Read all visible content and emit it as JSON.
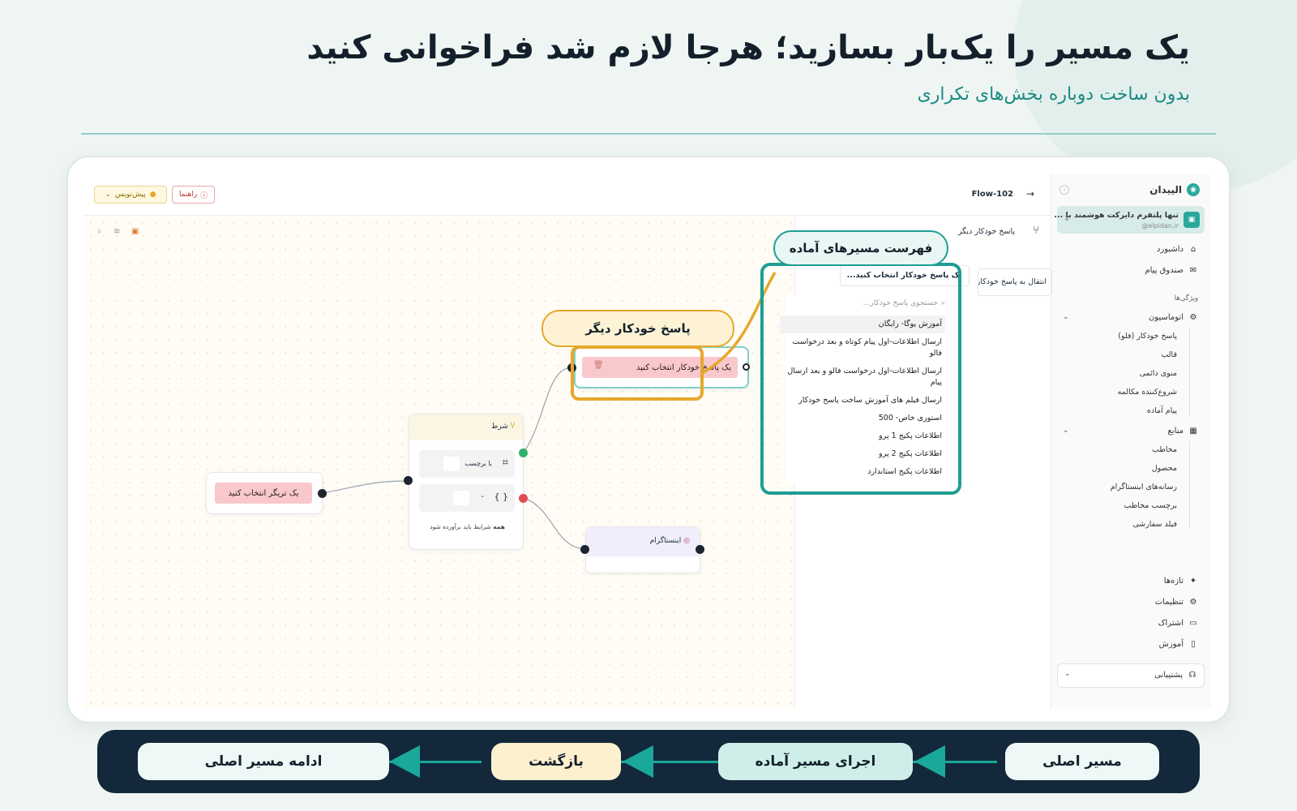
{
  "hero": {
    "title": "یک مسیر را یک‌بار بسازید؛ هرجا لازم شد فراخوانی کنید",
    "subtitle": "بدون ساخت دوباره بخش‌های تکراری"
  },
  "sidebar": {
    "brand": "الپیدان",
    "account_name": "تنها پلتفرم دایرکت هوشمند با ...",
    "account_handle": "@elpidan.ir",
    "dashboard": "داشبورد",
    "inbox": "صندوق پیام",
    "features_heading": "ویژگی‌ها",
    "automation": "اتوماسیون",
    "automation_items": [
      "پاسخ خودکار (فلو)",
      "قالب",
      "منوی دائمی",
      "شروع‌کننده مکالمه",
      "پیام آماده"
    ],
    "resources": "منابع",
    "resources_items": [
      "مخاطب",
      "محصول",
      "رسانه‌های اینستاگرام",
      "برچسب مخاطب",
      "فیلد سفارشی"
    ],
    "news": "تازه‌ها",
    "settings": "تنظیمات",
    "subscription": "اشتراک",
    "tutorial": "آموزش",
    "support": "پشتیبانی"
  },
  "topbar": {
    "flow_name": "Flow-102",
    "help_label": "راهنما",
    "draft_label": "پیش‌نویس"
  },
  "panel": {
    "title": "پاسخ خودکار دیگر",
    "transfer_label": "انتقال به پاسخ خودکار",
    "select_value": "یک پاسخ خودکار انتخاب کنید...",
    "search_placeholder": "جستجوی پاسخ خودکار...",
    "options": [
      "آموزش یوگا- رایگان",
      "ارسال اطلاعات-اول پیام کوتاه و بعد درخواست فالو",
      "ارسال اطلاعات-اول درخواست فالو و بعد ارسال پیام",
      "ارسال فیلم های آموزش ساخت پاسخ خودکار",
      "استوری خاص- 500",
      "اطلاعات پکیج 1 پرو",
      "اطلاعات پکیج 2 پرو",
      "اطلاعات پکیج استاندارد"
    ]
  },
  "canvas": {
    "trigger_label": "یک تریگر انتخاب کنید",
    "condition_title": "شرط",
    "condition_tag_label": "با برچسب",
    "condition_footer_bold": "همه",
    "condition_footer": "شرایط باید برآورده شود",
    "flow_node_label": "یک پاسخ خودکار انتخاب کنید",
    "instagram_label": "اینستاگرام"
  },
  "callouts": {
    "ready_flows": "فهرست مسیرهای آماده",
    "other_auto_reply": "پاسخ خودکار دیگر"
  },
  "steps": [
    "مسیر اصلی",
    "اجرای مسیر آماده",
    "بازگشت",
    "ادامه مسیر اصلی"
  ],
  "colors": {
    "accent_teal": "#1e9e94",
    "accent_gold": "#e6a82b",
    "bar_bg": "#13283a"
  }
}
